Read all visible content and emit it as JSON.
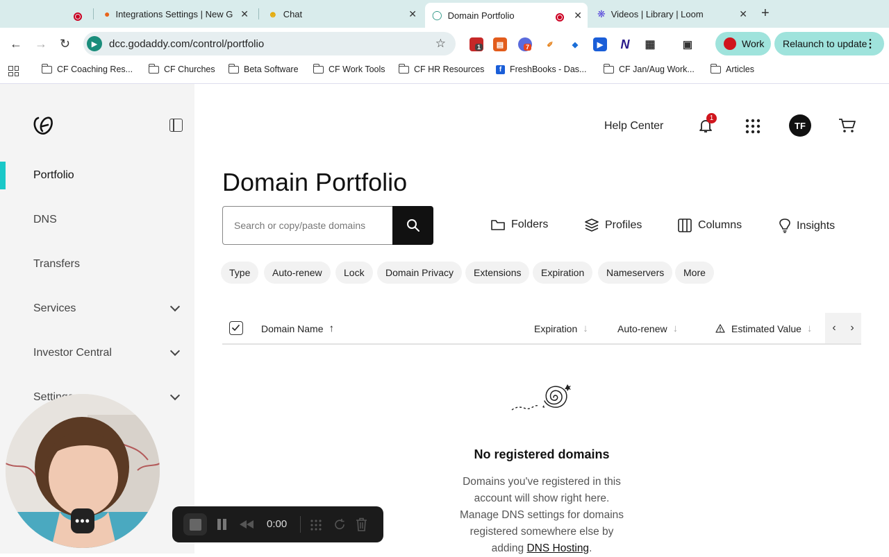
{
  "browser": {
    "tabs": [
      {
        "label": "Integrations Settings | New G",
        "active": false
      },
      {
        "label": "Chat",
        "active": false
      },
      {
        "label": "Domain Portfolio",
        "active": true
      },
      {
        "label": "Videos | Library | Loom",
        "active": false
      }
    ],
    "url": "dcc.godaddy.com/control/portfolio",
    "extension_badges": [
      "1",
      "7"
    ],
    "profile_label": "Work",
    "relaunch_label": "Relaunch to update",
    "bookmarks": [
      "CF Coaching Res...",
      "CF Churches",
      "Beta Software",
      "CF Work Tools",
      "CF HR Resources",
      "FreshBooks - Das...",
      "CF Jan/Aug Work...",
      "Articles"
    ]
  },
  "sidebar": {
    "items": [
      {
        "label": "Portfolio",
        "active": true
      },
      {
        "label": "DNS"
      },
      {
        "label": "Transfers"
      },
      {
        "label": "Services",
        "expandable": true
      },
      {
        "label": "Investor Central",
        "expandable": true
      },
      {
        "label": "Settings",
        "expandable": true
      }
    ]
  },
  "header": {
    "help_label": "Help Center",
    "notification_count": "1",
    "avatar_initials": "TF"
  },
  "main": {
    "title": "Domain Portfolio",
    "search_placeholder": "Search or copy/paste domains",
    "actions": [
      "Folders",
      "Profiles",
      "Columns",
      "Insights"
    ],
    "filters": [
      "Type",
      "Auto-renew",
      "Lock",
      "Domain Privacy",
      "Extensions",
      "Expiration",
      "Nameservers",
      "More"
    ],
    "columns": {
      "name": "Domain Name",
      "expiration": "Expiration",
      "autorenew": "Auto-renew",
      "value": "Estimated Value"
    },
    "empty": {
      "title": "No registered domains",
      "text": "Domains you've registered in this account will show right here. Manage DNS settings for domains registered somewhere else by adding",
      "link": "DNS Hosting",
      "after": "."
    }
  },
  "recorder": {
    "time": "0:00",
    "menu_glyph": "•••"
  },
  "colors": {
    "accent": "#1ac8c8",
    "chrome_bg": "#d9ecec",
    "sidebar_bg": "#f4f4f4",
    "badge": "#d0151d"
  }
}
